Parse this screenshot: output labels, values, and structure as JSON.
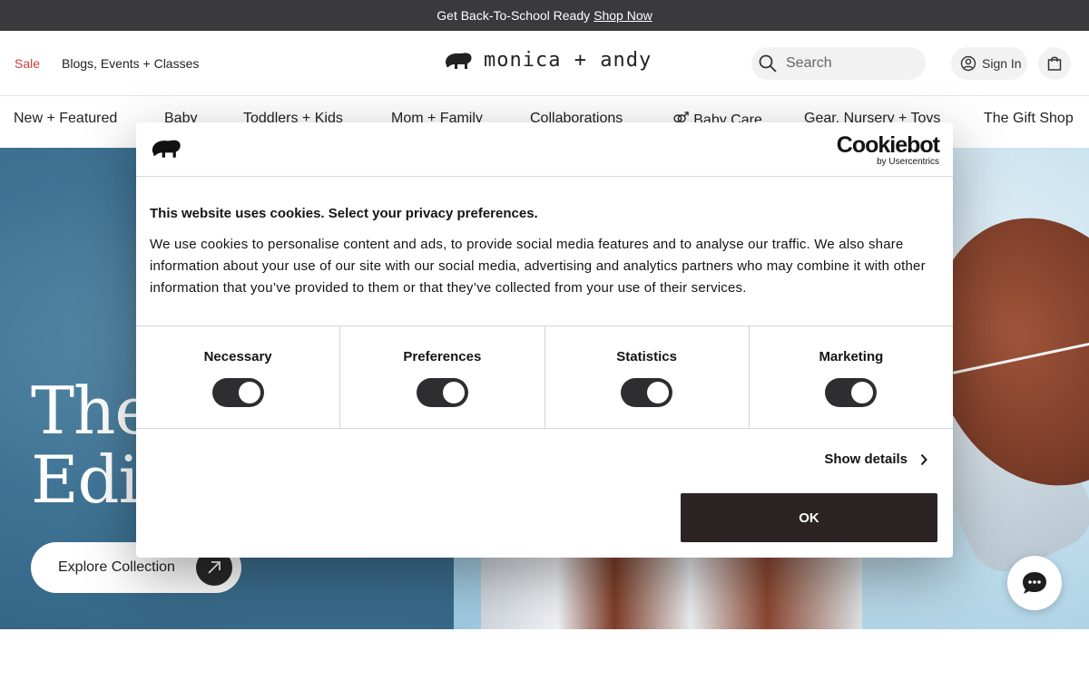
{
  "announcement": {
    "text": "Get Back-To-School Ready",
    "link": "Shop Now"
  },
  "header": {
    "sale": "Sale",
    "blogs": "Blogs, Events + Classes",
    "logo_text": "monica + andy",
    "search_placeholder": "Search",
    "signin": "Sign In"
  },
  "nav": {
    "items": [
      "New + Featured",
      "Baby",
      "Toddlers + Kids",
      "Mom + Family",
      "Collaborations",
      "Baby Care",
      "Gear, Nursery + Toys",
      "The Gift Shop"
    ]
  },
  "hero": {
    "title_line1": "The",
    "title_line2": "Edit",
    "button": "Explore Collection"
  },
  "cookie": {
    "brand": "Cookiebot",
    "brand_sub": "by Usercentrics",
    "title": "This website uses cookies. Select your privacy preferences.",
    "body": "We use cookies to personalise content and ads, to provide social media features and to analyse our traffic. We also share information about your use of our site with our social media, advertising and analytics partners who may combine it with other information that you’ve provided to them or that they’ve collected from your use of their services.",
    "toggles": [
      {
        "label": "Necessary",
        "on": true
      },
      {
        "label": "Preferences",
        "on": true
      },
      {
        "label": "Statistics",
        "on": true
      },
      {
        "label": "Marketing",
        "on": true
      }
    ],
    "show_details": "Show details",
    "ok": "OK"
  },
  "colors": {
    "accent_sale": "#c63b3b",
    "dark": "#2b2324",
    "announce_bg": "#3a3a3c"
  }
}
